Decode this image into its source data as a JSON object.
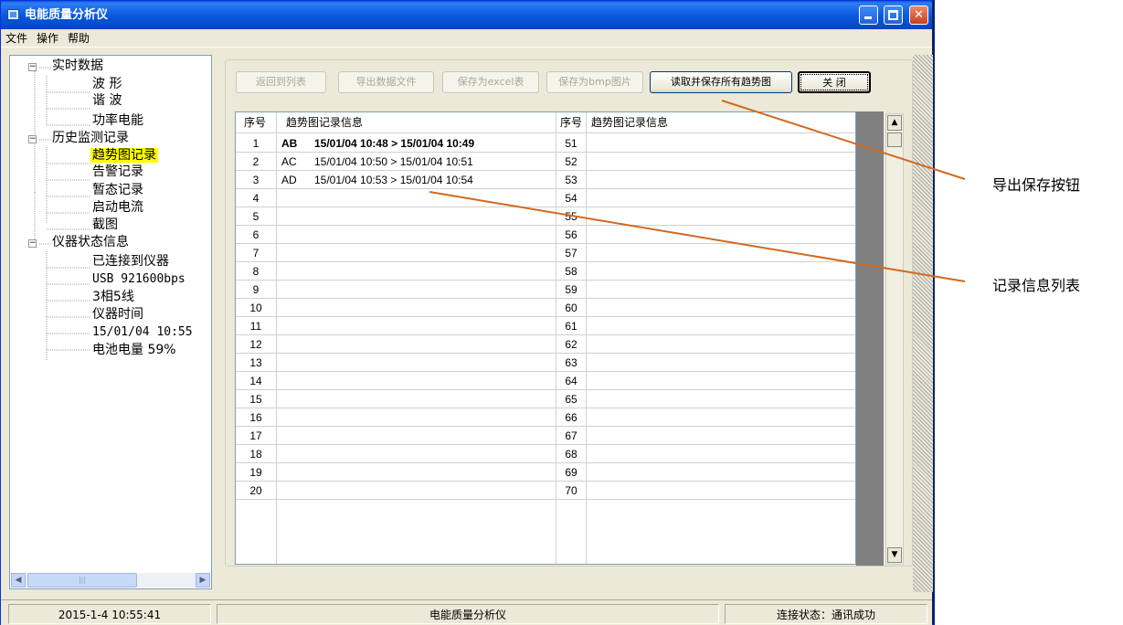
{
  "window": {
    "title": "电能质量分析仪"
  },
  "menu": [
    "文件",
    "操作",
    "帮助"
  ],
  "tree": {
    "realtime": {
      "label": "实时数据",
      "children": [
        "波 形",
        "谐 波",
        "功率电能"
      ]
    },
    "history": {
      "label": "历史监测记录",
      "children": [
        "趋势图记录",
        "告警记录",
        "暂态记录",
        "启动电流",
        "截图"
      ],
      "selected": "趋势图记录"
    },
    "device": {
      "label": "仪器状态信息",
      "children": [
        "已连接到仪器",
        "USB 921600bps",
        "3相5线",
        "仪器时间",
        "15/01/04 10:55",
        "电池电量 59%"
      ]
    }
  },
  "toolbar": {
    "back_label": "返回到列表",
    "export_label": "导出数据文件",
    "excel_label": "保存为excel表",
    "bmp_label": "保存为bmp图片",
    "read_save_label": "读取并保存所有趋势图",
    "close_label": "关 闭"
  },
  "table": {
    "headers": [
      "序号",
      "趋势图记录信息",
      "序号",
      "趋势图记录信息"
    ],
    "left_rows": [
      {
        "no": "1",
        "code": "AB",
        "info": "15/01/04 10:48 > 15/01/04 10:49"
      },
      {
        "no": "2",
        "code": "AC",
        "info": "15/01/04 10:50 > 15/01/04 10:51"
      },
      {
        "no": "3",
        "code": "AD",
        "info": "15/01/04 10:53 > 15/01/04 10:54"
      },
      {
        "no": "4",
        "code": "",
        "info": ""
      },
      {
        "no": "5",
        "code": "",
        "info": ""
      },
      {
        "no": "6",
        "code": "",
        "info": ""
      },
      {
        "no": "7",
        "code": "",
        "info": ""
      },
      {
        "no": "8",
        "code": "",
        "info": ""
      },
      {
        "no": "9",
        "code": "",
        "info": ""
      },
      {
        "no": "10",
        "code": "",
        "info": ""
      },
      {
        "no": "11",
        "code": "",
        "info": ""
      },
      {
        "no": "12",
        "code": "",
        "info": ""
      },
      {
        "no": "13",
        "code": "",
        "info": ""
      },
      {
        "no": "14",
        "code": "",
        "info": ""
      },
      {
        "no": "15",
        "code": "",
        "info": ""
      },
      {
        "no": "16",
        "code": "",
        "info": ""
      },
      {
        "no": "17",
        "code": "",
        "info": ""
      },
      {
        "no": "18",
        "code": "",
        "info": ""
      },
      {
        "no": "19",
        "code": "",
        "info": ""
      },
      {
        "no": "20",
        "code": "",
        "info": ""
      }
    ],
    "right_numbers": [
      "51",
      "52",
      "53",
      "54",
      "55",
      "56",
      "57",
      "58",
      "59",
      "60",
      "61",
      "62",
      "63",
      "64",
      "65",
      "66",
      "67",
      "68",
      "69",
      "70"
    ]
  },
  "status": {
    "datetime": "2015-1-4 10:55:41",
    "center": "电能质量分析仪",
    "connection": "连接状态：通讯成功"
  },
  "annotations": {
    "export_buttons": "导出保存按钮",
    "record_list": "记录信息列表"
  },
  "colors": {
    "annotation_line": "#d2691e",
    "selected_highlight": "#ffff00",
    "title_bar": "#0a5ade"
  }
}
